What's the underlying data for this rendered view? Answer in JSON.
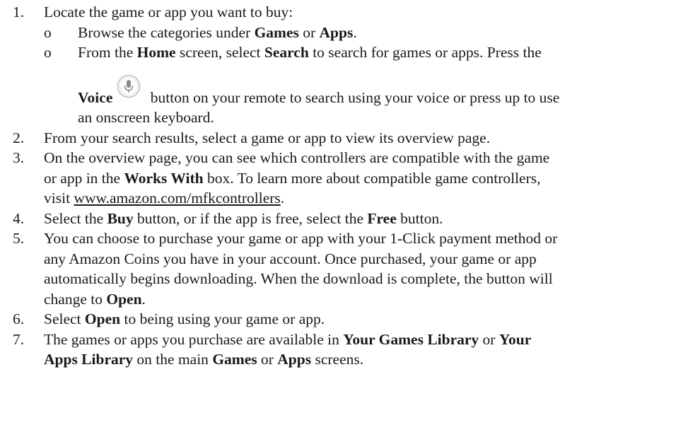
{
  "steps": [
    {
      "number": "1.",
      "text": "Locate the game or app you want to buy:",
      "sub": [
        {
          "bullet": "o",
          "t1": "Browse the categories under ",
          "b1": "Games",
          "t2": " or ",
          "b2": "Apps",
          "t3": "."
        },
        {
          "bullet": "o",
          "t1": "From the ",
          "b1": "Home",
          "t2": " screen, select ",
          "b2": "Search",
          "t3": " to search for games or apps.  Press the",
          "voice_bold": "Voice",
          "icon": "microphone-icon",
          "after_icon": " button on your remote to search using your voice or press up to use",
          "line3": "an onscreen keyboard."
        }
      ]
    },
    {
      "number": "2.",
      "text": "From your search results, select a game or app to view its overview page."
    },
    {
      "number": "3.",
      "t1": "On the overview page, you can see which controllers are compatible with the game",
      "t2": "or app in the ",
      "b1": "Works With",
      "t3": " box. To learn more about compatible game controllers,",
      "t4": "visit ",
      "link": "www.amazon.com/mfkcontrollers",
      "t5": "."
    },
    {
      "number": "4.",
      "t1": "Select the ",
      "b1": "Buy",
      "t2": " button, or if the app is free, select the ",
      "b2": "Free",
      "t3": " button."
    },
    {
      "number": "5.",
      "l1": "You can choose to purchase your game or app with your 1-Click payment method or",
      "l2": "any Amazon Coins you have in your account. Once purchased, your game or app",
      "l3": "automatically begins downloading. When the download is complete, the button will",
      "l4": "change to ",
      "b1": "Open",
      "l5": "."
    },
    {
      "number": "6.",
      "t1": "Select ",
      "b1": "Open",
      "t2": " to being using your game or app."
    },
    {
      "number": "7.",
      "t1": "The games or apps you purchase are available in ",
      "b1": "Your Games Library",
      "t2": " or ",
      "b2": "Your",
      "b3": "Apps Library",
      "t3": " on the main ",
      "b4": "Games",
      "t4": " or ",
      "b5": "Apps",
      "t5": " screens."
    }
  ],
  "colors": {
    "text": "#1a1a1a",
    "icon_ring": "#b9b9b9",
    "icon_fill": "#8a8a8a"
  }
}
